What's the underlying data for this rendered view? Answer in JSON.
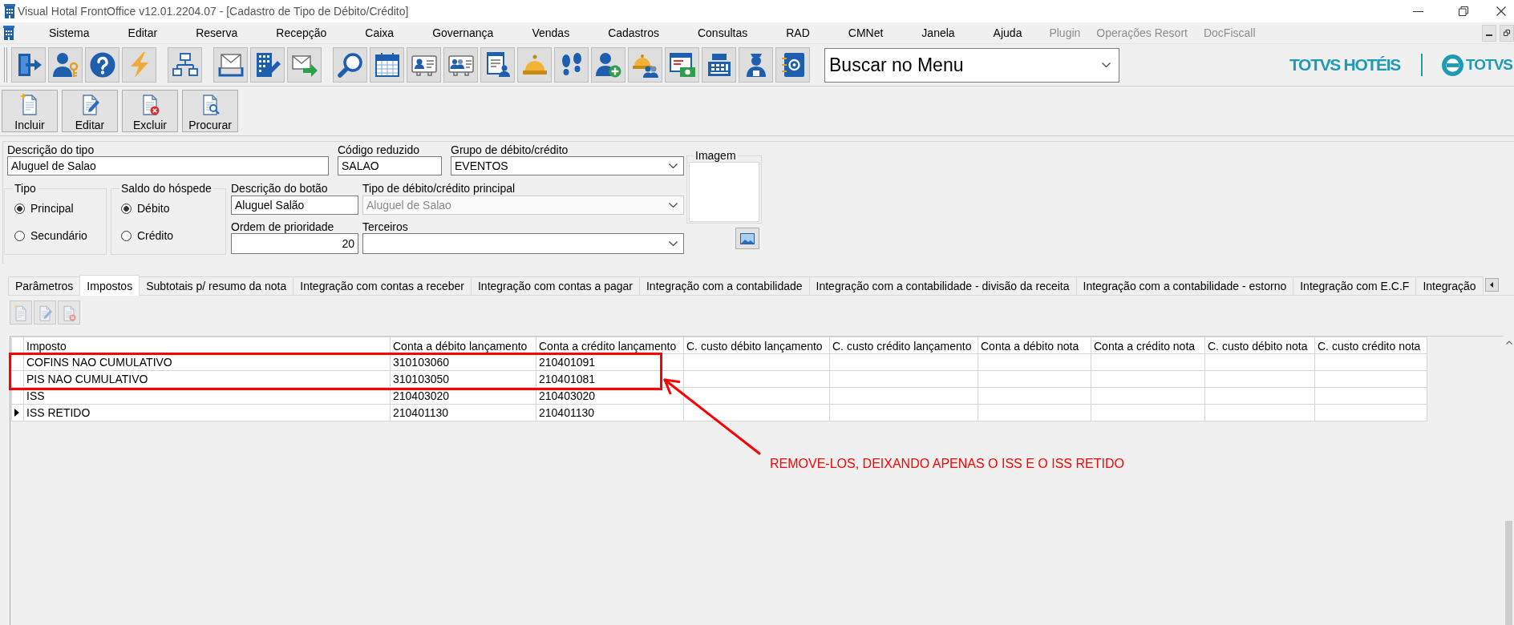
{
  "window": {
    "title": "Visual Hotal FrontOffice v12.01.2204.07 - [Cadastro de Tipo de Débito/Crédito]"
  },
  "menu": [
    {
      "label": "Sistema",
      "disabled": false
    },
    {
      "label": "Editar",
      "disabled": false
    },
    {
      "label": "Reserva",
      "disabled": false
    },
    {
      "label": "Recepção",
      "disabled": false
    },
    {
      "label": "Caixa",
      "disabled": false
    },
    {
      "label": "Governança",
      "disabled": false
    },
    {
      "label": "Vendas",
      "disabled": false
    },
    {
      "label": "Cadastros",
      "disabled": false
    },
    {
      "label": "Consultas",
      "disabled": false
    },
    {
      "label": "RAD",
      "disabled": false
    },
    {
      "label": "CMNet",
      "disabled": false
    },
    {
      "label": "Janela",
      "disabled": false
    },
    {
      "label": "Ajuda",
      "disabled": false
    },
    {
      "label": "Plugin",
      "disabled": true
    },
    {
      "label": "Operações Resort",
      "disabled": true
    },
    {
      "label": "DocFiscall",
      "disabled": true
    }
  ],
  "toolbar": {
    "groups": [
      {
        "buttons": [
          {
            "kind": "exit"
          },
          {
            "kind": "access"
          },
          {
            "kind": "help"
          },
          {
            "kind": "flash"
          }
        ]
      },
      {
        "buttons": [
          {
            "kind": "network"
          }
        ]
      },
      {
        "buttons": [
          {
            "kind": "inbox"
          },
          {
            "kind": "edit"
          },
          {
            "kind": "send"
          }
        ]
      },
      {
        "buttons": [
          {
            "kind": "search"
          },
          {
            "kind": "calendar"
          },
          {
            "kind": "card"
          },
          {
            "kind": "cards"
          },
          {
            "kind": "report"
          },
          {
            "kind": "bell"
          },
          {
            "kind": "steps"
          },
          {
            "kind": "adduser"
          },
          {
            "kind": "bellgroup"
          },
          {
            "kind": "billing"
          },
          {
            "kind": "register"
          },
          {
            "kind": "maid"
          },
          {
            "kind": "contacts"
          }
        ]
      }
    ],
    "menu_search": {
      "value": "Buscar no Menu"
    },
    "brand": {
      "product": "TOTVS HOTÉIS",
      "company": "TOTVS"
    }
  },
  "actions": [
    {
      "label": "Incluir",
      "kind": "new"
    },
    {
      "label": "Editar",
      "kind": "edit"
    },
    {
      "label": "Excluir",
      "kind": "delete"
    },
    {
      "label": "Procurar",
      "kind": "find"
    }
  ],
  "form": {
    "description": {
      "label": "Descrição do tipo",
      "value": "Aluguel de Salao"
    },
    "short_code": {
      "label": "Código reduzido",
      "value": "SALAO"
    },
    "group": {
      "label": "Grupo de débito/crédito",
      "value": "EVENTOS",
      "disabled": false
    },
    "image": {
      "label": "Imagem"
    },
    "type": {
      "label": "Tipo",
      "options": [
        {
          "label": "Principal",
          "selected": true
        },
        {
          "label": "Secundário",
          "selected": false
        }
      ]
    },
    "guest_balance": {
      "label": "Saldo do hóspede",
      "options": [
        {
          "label": "Débito",
          "selected": true
        },
        {
          "label": "Crédito",
          "selected": false
        }
      ]
    },
    "button_description": {
      "label": "Descrição do botão",
      "value": "Aluguel Salão"
    },
    "main_type": {
      "label": "Tipo de débito/crédito principal",
      "value": "Aluguel de Salao",
      "disabled": true
    },
    "priority": {
      "label": "Ordem de prioridade",
      "value": "20"
    },
    "third_party": {
      "label": "Terceiros",
      "disabled": false
    }
  },
  "tabs": [
    {
      "label": "Parâmetros",
      "selected": false
    },
    {
      "label": "Impostos",
      "selected": true
    },
    {
      "label": "Subtotais p/ resumo da nota",
      "selected": false
    },
    {
      "label": "Integração com contas a receber",
      "selected": false
    },
    {
      "label": "Integração com contas a pagar",
      "selected": false
    },
    {
      "label": "Integração com a contabilidade",
      "selected": false
    },
    {
      "label": "Integração com a contabilidade - divisão da receita",
      "selected": false
    },
    {
      "label": "Integração com a contabilidade - estorno",
      "selected": false
    },
    {
      "label": "Integração com E.C.F",
      "selected": false
    },
    {
      "label": "Integração",
      "selected": false
    }
  ],
  "tab_toolbar": [
    {
      "kind": "new",
      "disabled": true
    },
    {
      "kind": "edit",
      "disabled": true
    },
    {
      "kind": "delete",
      "disabled": true
    }
  ],
  "table": {
    "columns": [
      "Imposto",
      "Conta a débito lançamento",
      "Conta a crédito lançamento",
      "C. custo débito lançamento",
      "C. custo crédito lançamento",
      "Conta a débito nota",
      "Conta a crédito nota",
      "C. custo débito nota",
      "C. custo crédito nota"
    ],
    "rows": [
      {
        "cells": [
          "COFINS NAO CUMULATIVO",
          "310103060",
          "210401091"
        ],
        "current": false,
        "marked": true
      },
      {
        "cells": [
          "PIS NAO CUMULATIVO",
          "310103050",
          "210401081"
        ],
        "current": false,
        "marked": true
      },
      {
        "cells": [
          "ISS",
          "210403020",
          "210403020"
        ],
        "current": false,
        "marked": false
      },
      {
        "cells": [
          "ISS RETIDO",
          "210401130",
          "210401130"
        ],
        "current": true,
        "marked": false
      }
    ]
  },
  "annotation": {
    "note": "REMOVE-LOS, DEIXANDO APENAS O ISS E O ISS RETIDO"
  }
}
